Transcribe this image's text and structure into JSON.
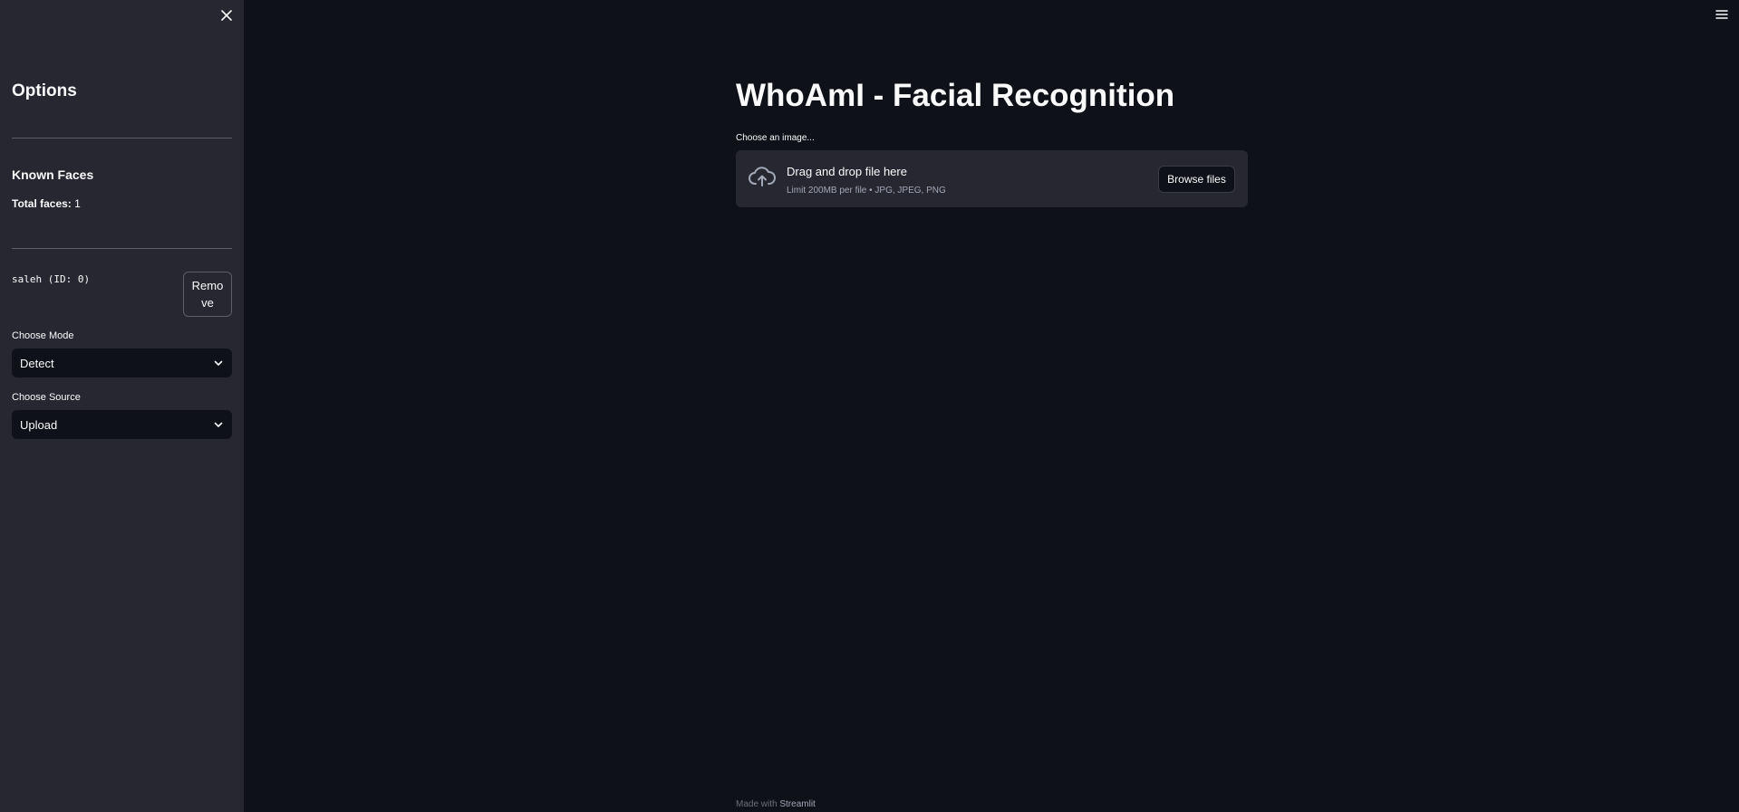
{
  "sidebar": {
    "title": "Options",
    "known_faces_heading": "Known Faces",
    "total_faces_label": "Total faces:",
    "total_faces_count": "1",
    "face_entry": "saleh (ID: 0)",
    "remove_label": "Remove",
    "mode": {
      "label": "Choose Mode",
      "value": "Detect"
    },
    "source": {
      "label": "Choose Source",
      "value": "Upload"
    }
  },
  "main": {
    "title": "WhoAmI - Facial Recognition",
    "uploader": {
      "label": "Choose an image...",
      "drop_title": "Drag and drop file here",
      "limit_text": "Limit 200MB per file • JPG, JPEG, PNG",
      "browse_label": "Browse files"
    }
  },
  "footer": {
    "prefix": "Made with",
    "link": "Streamlit"
  },
  "icons": {
    "close": "close-icon",
    "menu": "hamburger-menu-icon",
    "chevron": "chevron-down-icon",
    "upload": "cloud-upload-icon"
  },
  "colors": {
    "background": "#0e1117",
    "sidebar": "#262730",
    "text": "#fafafa",
    "muted": "#a3a8b8"
  }
}
